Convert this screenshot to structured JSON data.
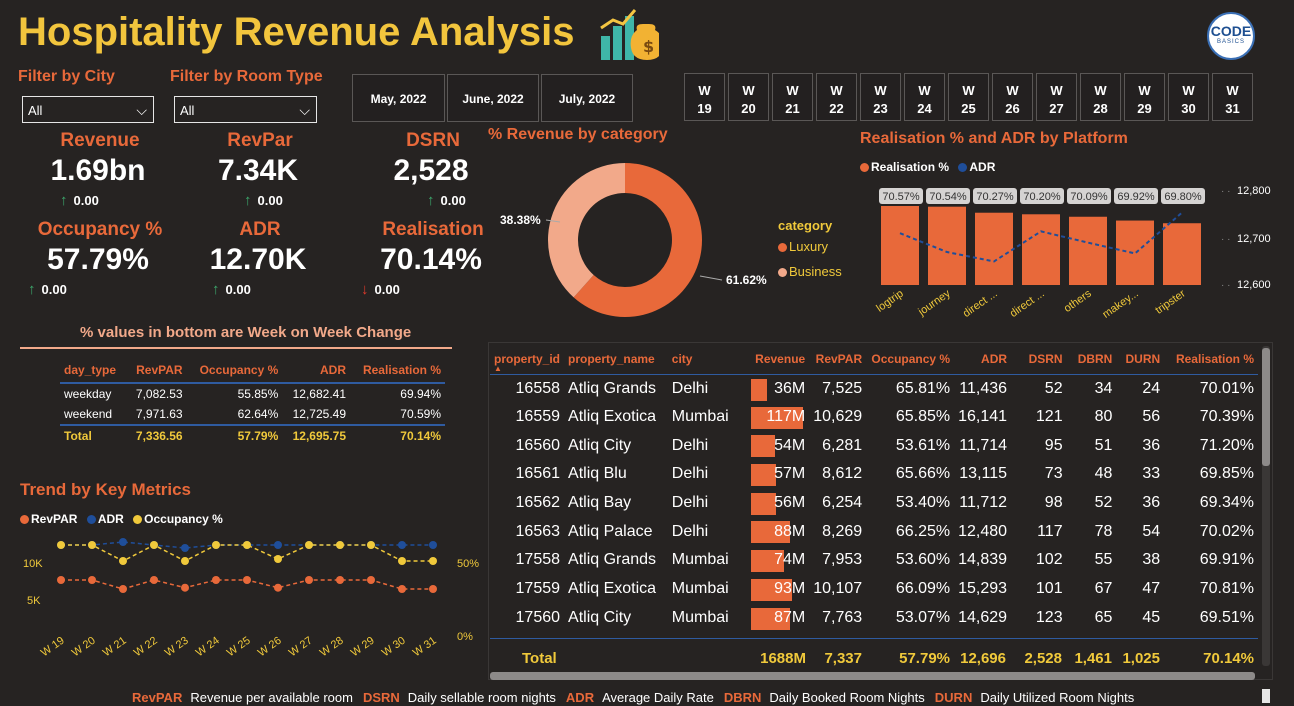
{
  "title": "Hospitality Revenue Analysis",
  "logo": {
    "line1": "CODE",
    "line2": "BASICS"
  },
  "filters": {
    "city_label": "Filter by City",
    "city_value": "All",
    "room_label": "Filter by Room Type",
    "room_value": "All"
  },
  "months": [
    "May, 2022",
    "June, 2022",
    "July, 2022"
  ],
  "weeks": [
    [
      "W",
      "19"
    ],
    [
      "W",
      "20"
    ],
    [
      "W",
      "21"
    ],
    [
      "W",
      "22"
    ],
    [
      "W",
      "23"
    ],
    [
      "W",
      "24"
    ],
    [
      "W",
      "25"
    ],
    [
      "W",
      "26"
    ],
    [
      "W",
      "27"
    ],
    [
      "W",
      "28"
    ],
    [
      "W",
      "29"
    ],
    [
      "W",
      "30"
    ],
    [
      "W",
      "31"
    ]
  ],
  "kpis": [
    {
      "label": "Revenue",
      "value": "1.69bn",
      "change": "0.00",
      "arrow": "↑"
    },
    {
      "label": "RevPar",
      "value": "7.34K",
      "change": "0.00",
      "arrow": "↑"
    },
    {
      "label": "DSRN",
      "value": "2,528",
      "change": "0.00",
      "arrow": "↑"
    },
    {
      "label": "Occupancy %",
      "value": "57.79%",
      "change": "0.00",
      "arrow": "↑"
    },
    {
      "label": "ADR",
      "value": "12.70K",
      "change": "0.00",
      "arrow": "↑"
    },
    {
      "label": "Realisation",
      "value": "70.14%",
      "change": "0.00",
      "arrow": "↓"
    }
  ],
  "colors": {
    "accent": "#e8693a",
    "yellow": "#f0c93b",
    "blue": "#1f4e9a",
    "light": "#f2a98a",
    "background": "#262322"
  },
  "week_table": {
    "title": "% values in bottom are Week on Week Change",
    "headers": [
      "day_type",
      "RevPAR",
      "Occupancy %",
      "ADR",
      "Realisation %"
    ],
    "rows": [
      [
        "weekday",
        "7,082.53",
        "55.85%",
        "12,682.41",
        "69.94%"
      ],
      [
        "weekend",
        "7,971.63",
        "62.64%",
        "12,725.49",
        "70.59%"
      ]
    ],
    "total": [
      "Total",
      "7,336.56",
      "57.79%",
      "12,695.75",
      "70.14%"
    ]
  },
  "donut": {
    "title": "% Revenue by category",
    "legend_title": "category",
    "labels": [
      "61.62%",
      "38.38%"
    ],
    "chart_data": {
      "type": "pie",
      "categories": [
        "Luxury",
        "Business"
      ],
      "values": [
        61.62,
        38.38
      ]
    }
  },
  "platform": {
    "title": "Realisation % and ADR by Platform",
    "legend": [
      "Realisation %",
      "ADR"
    ],
    "y_ticks": [
      "12,800",
      "12,700",
      "12,600"
    ],
    "chart_data": {
      "type": "bar",
      "categories": [
        "logtrip",
        "journey",
        "direct ...",
        "direct ...",
        "others",
        "makey...",
        "tripster"
      ],
      "series": [
        {
          "name": "Realisation %",
          "values": [
            70.57,
            70.54,
            70.27,
            70.2,
            70.09,
            69.92,
            69.8
          ],
          "labels": [
            "70.57%",
            "70.54%",
            "70.27%",
            "70.20%",
            "70.09%",
            "69.92%",
            "69.80%"
          ]
        },
        {
          "name": "ADR",
          "values": [
            12708,
            12668,
            12648,
            12712,
            12688,
            12665,
            12752
          ]
        }
      ],
      "ylim": [
        12600,
        12800
      ]
    }
  },
  "trend": {
    "title": "Trend by Key Metrics",
    "legend": [
      "RevPAR",
      "ADR",
      "Occupancy %"
    ],
    "left_ticks": [
      "10K",
      "5K"
    ],
    "right_ticks": [
      "50%",
      "0%"
    ],
    "chart_data": {
      "type": "line",
      "x": [
        "W 19",
        "W 20",
        "W 21",
        "W 22",
        "W 23",
        "W 24",
        "W 25",
        "W 26",
        "W 27",
        "W 28",
        "W 29",
        "W 30",
        "W 31"
      ],
      "series": [
        {
          "name": "RevPAR",
          "axis": "left",
          "values": [
            7500,
            7500,
            6800,
            7500,
            6900,
            7500,
            7500,
            6900,
            7500,
            7500,
            7500,
            6800,
            6800
          ]
        },
        {
          "name": "ADR",
          "axis": "left",
          "values": [
            12700,
            12700,
            12750,
            12700,
            12650,
            12700,
            12700,
            12700,
            12700,
            12700,
            12700,
            12700,
            12700
          ]
        },
        {
          "name": "Occupancy %",
          "axis": "right",
          "values": [
            62,
            62,
            54,
            62,
            54,
            62,
            62,
            55,
            62,
            62,
            62,
            54,
            54
          ]
        }
      ],
      "ylim_left": [
        0,
        15000
      ],
      "ylim_right": [
        0,
        100
      ]
    }
  },
  "property_table": {
    "headers": [
      "property_id",
      "property_name",
      "city",
      "Revenue",
      "RevPAR",
      "Occupancy %",
      "ADR",
      "DSRN",
      "DBRN",
      "DURN",
      "Realisation %"
    ],
    "revenue_max": 117,
    "rows": [
      {
        "id": "16558",
        "name": "Atliq Grands",
        "city": "Delhi",
        "revenue": "36M",
        "rev_num": 36,
        "revpar": "7,525",
        "occ": "65.81%",
        "adr": "11,436",
        "dsrn": "52",
        "dbrn": "34",
        "durn": "24",
        "real": "70.01%"
      },
      {
        "id": "16559",
        "name": "Atliq Exotica",
        "city": "Mumbai",
        "revenue": "117M",
        "rev_num": 117,
        "revpar": "10,629",
        "occ": "65.85%",
        "adr": "16,141",
        "dsrn": "121",
        "dbrn": "80",
        "durn": "56",
        "real": "70.39%"
      },
      {
        "id": "16560",
        "name": "Atliq City",
        "city": "Delhi",
        "revenue": "54M",
        "rev_num": 54,
        "revpar": "6,281",
        "occ": "53.61%",
        "adr": "11,714",
        "dsrn": "95",
        "dbrn": "51",
        "durn": "36",
        "real": "71.20%"
      },
      {
        "id": "16561",
        "name": "Atliq Blu",
        "city": "Delhi",
        "revenue": "57M",
        "rev_num": 57,
        "revpar": "8,612",
        "occ": "65.66%",
        "adr": "13,115",
        "dsrn": "73",
        "dbrn": "48",
        "durn": "33",
        "real": "69.85%"
      },
      {
        "id": "16562",
        "name": "Atliq Bay",
        "city": "Delhi",
        "revenue": "56M",
        "rev_num": 56,
        "revpar": "6,254",
        "occ": "53.40%",
        "adr": "11,712",
        "dsrn": "98",
        "dbrn": "52",
        "durn": "36",
        "real": "69.34%"
      },
      {
        "id": "16563",
        "name": "Atliq Palace",
        "city": "Delhi",
        "revenue": "88M",
        "rev_num": 88,
        "revpar": "8,269",
        "occ": "66.25%",
        "adr": "12,480",
        "dsrn": "117",
        "dbrn": "78",
        "durn": "54",
        "real": "70.02%"
      },
      {
        "id": "17558",
        "name": "Atliq Grands",
        "city": "Mumbai",
        "revenue": "74M",
        "rev_num": 74,
        "revpar": "7,953",
        "occ": "53.60%",
        "adr": "14,839",
        "dsrn": "102",
        "dbrn": "55",
        "durn": "38",
        "real": "69.91%"
      },
      {
        "id": "17559",
        "name": "Atliq Exotica",
        "city": "Mumbai",
        "revenue": "93M",
        "rev_num": 93,
        "revpar": "10,107",
        "occ": "66.09%",
        "adr": "15,293",
        "dsrn": "101",
        "dbrn": "67",
        "durn": "47",
        "real": "70.81%"
      },
      {
        "id": "17560",
        "name": "Atliq City",
        "city": "Mumbai",
        "revenue": "87M",
        "rev_num": 87,
        "revpar": "7,763",
        "occ": "53.07%",
        "adr": "14,629",
        "dsrn": "123",
        "dbrn": "65",
        "durn": "45",
        "real": "69.51%"
      }
    ],
    "total": [
      "Total",
      "1688M",
      "7,337",
      "57.79%",
      "12,696",
      "2,528",
      "1,461",
      "1,025",
      "70.14%"
    ]
  },
  "footer": [
    {
      "k": "RevPAR",
      "v": "Revenue per available room"
    },
    {
      "k": "DSRN",
      "v": "Daily sellable room nights"
    },
    {
      "k": "ADR",
      "v": "Average Daily Rate"
    },
    {
      "k": "DBRN",
      "v": "Daily Booked Room Nights"
    },
    {
      "k": "DURN",
      "v": "Daily Utilized Room Nights"
    }
  ]
}
